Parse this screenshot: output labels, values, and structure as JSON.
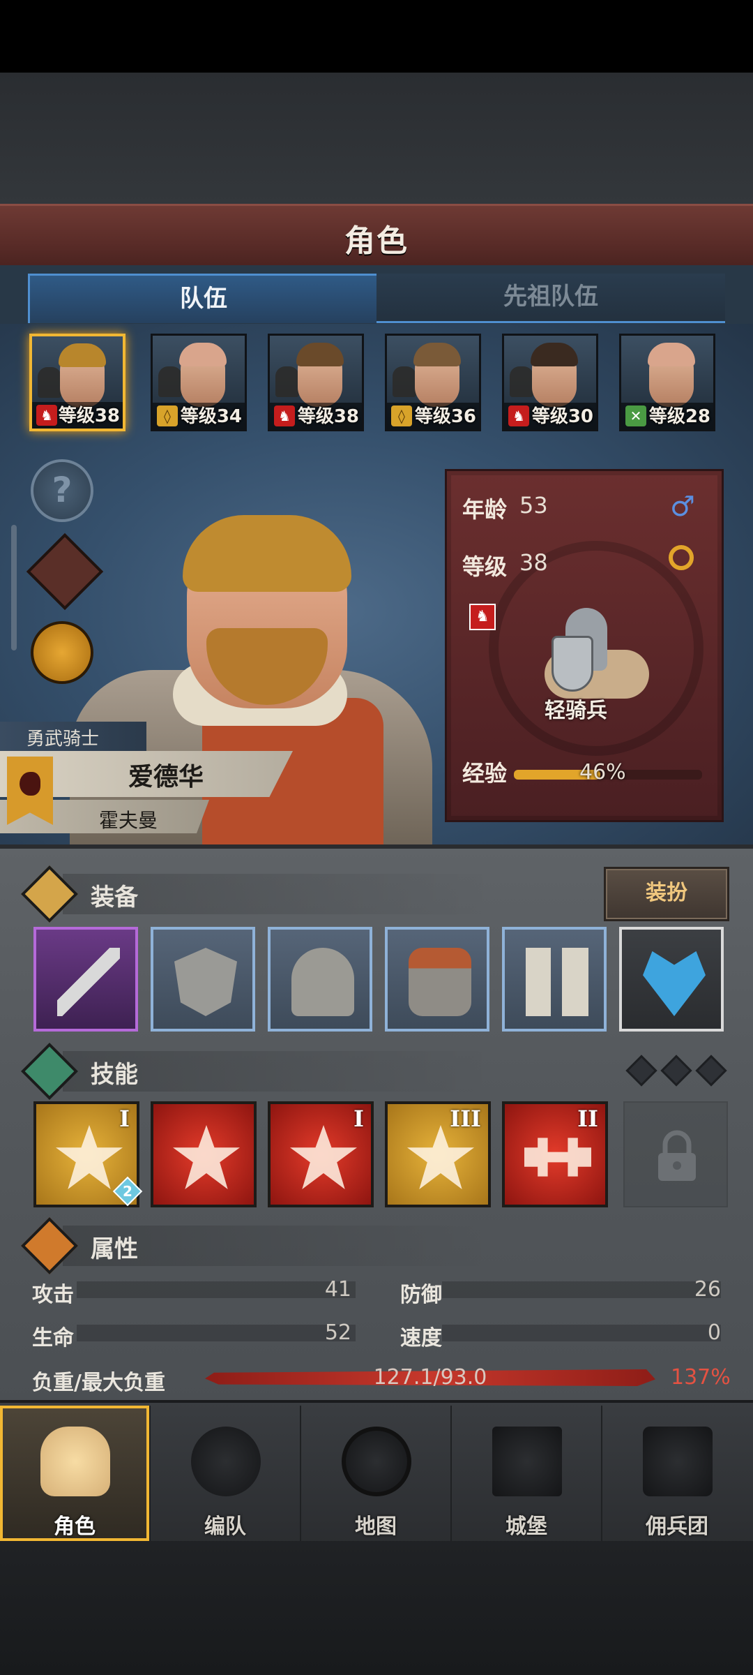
{
  "header": {
    "title": "角色"
  },
  "tabs": [
    {
      "label": "队伍",
      "active": true
    },
    {
      "label": "先祖队伍",
      "active": false
    }
  ],
  "party": [
    {
      "level_text": "等级38",
      "class_icon": "horse-icon",
      "hair": "#b8862c",
      "selected": true
    },
    {
      "level_text": "等级34",
      "class_icon": "shield-icon",
      "hair": "#d9a58c",
      "selected": false
    },
    {
      "level_text": "等级38",
      "class_icon": "horse-icon",
      "hair": "#6a4a2a",
      "selected": false
    },
    {
      "level_text": "等级36",
      "class_icon": "shield-icon",
      "hair": "#7a5a38",
      "selected": false
    },
    {
      "level_text": "等级30",
      "class_icon": "horse-icon",
      "hair": "#3a2a20",
      "selected": false
    },
    {
      "level_text": "等级28",
      "class_icon": "sword-icon",
      "hair": "#d9a58c",
      "selected": false
    }
  ],
  "side_buttons": {
    "help": "?"
  },
  "character": {
    "title": "勇武骑士",
    "first_name": "爱德华",
    "surname": "霍夫曼"
  },
  "info": {
    "age_label": "年龄",
    "age": "53",
    "gender_icon": "♂",
    "level_label": "等级",
    "level": "38",
    "unit": "轻骑兵",
    "xp_label": "经验",
    "xp_text": "46%",
    "xp_fraction": 0.46
  },
  "equipment": {
    "title": "装备",
    "dress_button": "装扮",
    "slots": [
      "sword-icon",
      "shield-icon",
      "helmet-icon",
      "armor-icon",
      "boots-icon",
      "amulet-icon"
    ]
  },
  "skills": {
    "title": "技能",
    "items": [
      {
        "tier": "I",
        "color": "gold",
        "badge": "2"
      },
      {
        "tier": "",
        "color": "red"
      },
      {
        "tier": "I",
        "color": "red"
      },
      {
        "tier": "III",
        "color": "gold"
      },
      {
        "tier": "II",
        "color": "red"
      }
    ]
  },
  "attributes": {
    "title": "属性",
    "attack_label": "攻击",
    "attack": "41",
    "defense_label": "防御",
    "defense": "26",
    "hp_label": "生命",
    "hp": "52",
    "speed_label": "速度",
    "speed": "0",
    "load_label": "负重/最大负重",
    "load": "127.1/93.0",
    "load_pct": "137%"
  },
  "nav": [
    {
      "label": "角色",
      "active": true
    },
    {
      "label": "编队",
      "active": false
    },
    {
      "label": "地图",
      "active": false
    },
    {
      "label": "城堡",
      "active": false
    },
    {
      "label": "佣兵团",
      "active": false
    }
  ],
  "colors": {
    "accent": "#f1b733",
    "tab_blue": "#4f8fd0",
    "panel_red": "#5a2c28"
  }
}
